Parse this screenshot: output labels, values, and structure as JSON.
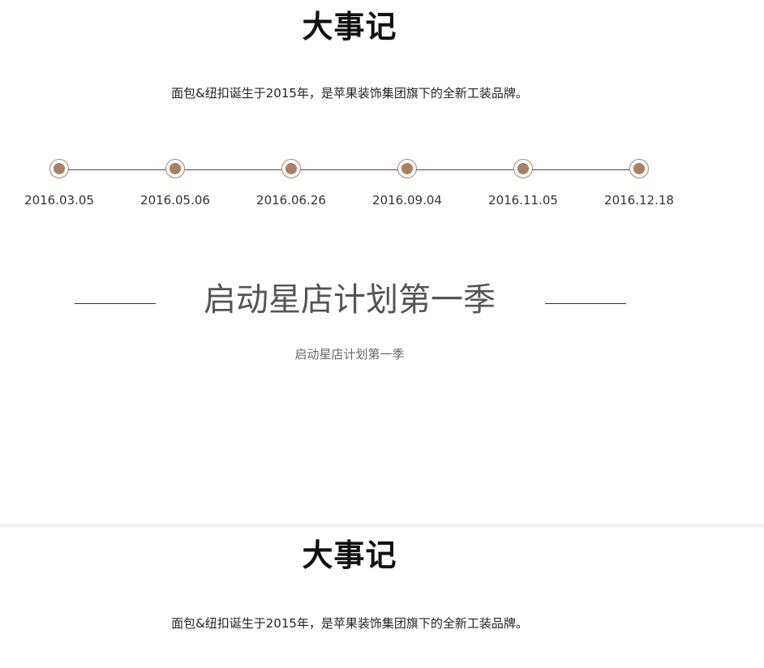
{
  "sections": [
    {
      "title": "大事记",
      "intro": "面包&纽扣诞生于2015年，是苹果装饰集团旗下的全新工装品牌。"
    },
    {
      "title": "大事记",
      "intro": "面包&纽扣诞生于2015年，是苹果装饰集团旗下的全新工装品牌。"
    }
  ],
  "timeline": {
    "items": [
      {
        "date": "2016.03.05"
      },
      {
        "date": "2016.05.06"
      },
      {
        "date": "2016.06.26"
      },
      {
        "date": "2016.09.04"
      },
      {
        "date": "2016.11.05"
      },
      {
        "date": "2016.12.18"
      }
    ]
  },
  "event": {
    "headline": "启动星店计划第一季",
    "subheadline": "启动星店计划第一季"
  },
  "colors": {
    "accent": "#a88066",
    "timeline_line": "#6b3b3b"
  }
}
